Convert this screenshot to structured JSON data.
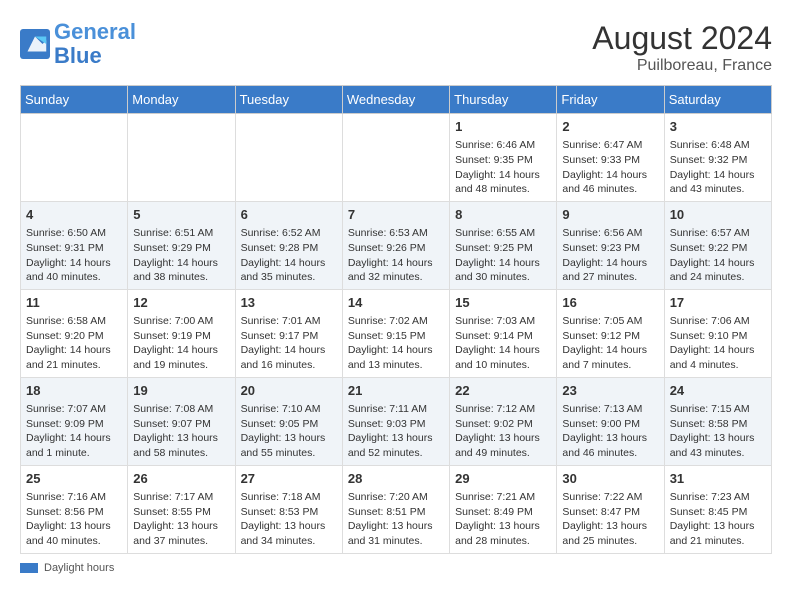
{
  "header": {
    "logo_line1": "General",
    "logo_line2": "Blue",
    "month_year": "August 2024",
    "location": "Puilboreau, France"
  },
  "weekdays": [
    "Sunday",
    "Monday",
    "Tuesday",
    "Wednesday",
    "Thursday",
    "Friday",
    "Saturday"
  ],
  "weeks": [
    [
      {
        "day": "",
        "info": ""
      },
      {
        "day": "",
        "info": ""
      },
      {
        "day": "",
        "info": ""
      },
      {
        "day": "",
        "info": ""
      },
      {
        "day": "1",
        "info": "Sunrise: 6:46 AM\nSunset: 9:35 PM\nDaylight: 14 hours\nand 48 minutes."
      },
      {
        "day": "2",
        "info": "Sunrise: 6:47 AM\nSunset: 9:33 PM\nDaylight: 14 hours\nand 46 minutes."
      },
      {
        "day": "3",
        "info": "Sunrise: 6:48 AM\nSunset: 9:32 PM\nDaylight: 14 hours\nand 43 minutes."
      }
    ],
    [
      {
        "day": "4",
        "info": "Sunrise: 6:50 AM\nSunset: 9:31 PM\nDaylight: 14 hours\nand 40 minutes."
      },
      {
        "day": "5",
        "info": "Sunrise: 6:51 AM\nSunset: 9:29 PM\nDaylight: 14 hours\nand 38 minutes."
      },
      {
        "day": "6",
        "info": "Sunrise: 6:52 AM\nSunset: 9:28 PM\nDaylight: 14 hours\nand 35 minutes."
      },
      {
        "day": "7",
        "info": "Sunrise: 6:53 AM\nSunset: 9:26 PM\nDaylight: 14 hours\nand 32 minutes."
      },
      {
        "day": "8",
        "info": "Sunrise: 6:55 AM\nSunset: 9:25 PM\nDaylight: 14 hours\nand 30 minutes."
      },
      {
        "day": "9",
        "info": "Sunrise: 6:56 AM\nSunset: 9:23 PM\nDaylight: 14 hours\nand 27 minutes."
      },
      {
        "day": "10",
        "info": "Sunrise: 6:57 AM\nSunset: 9:22 PM\nDaylight: 14 hours\nand 24 minutes."
      }
    ],
    [
      {
        "day": "11",
        "info": "Sunrise: 6:58 AM\nSunset: 9:20 PM\nDaylight: 14 hours\nand 21 minutes."
      },
      {
        "day": "12",
        "info": "Sunrise: 7:00 AM\nSunset: 9:19 PM\nDaylight: 14 hours\nand 19 minutes."
      },
      {
        "day": "13",
        "info": "Sunrise: 7:01 AM\nSunset: 9:17 PM\nDaylight: 14 hours\nand 16 minutes."
      },
      {
        "day": "14",
        "info": "Sunrise: 7:02 AM\nSunset: 9:15 PM\nDaylight: 14 hours\nand 13 minutes."
      },
      {
        "day": "15",
        "info": "Sunrise: 7:03 AM\nSunset: 9:14 PM\nDaylight: 14 hours\nand 10 minutes."
      },
      {
        "day": "16",
        "info": "Sunrise: 7:05 AM\nSunset: 9:12 PM\nDaylight: 14 hours\nand 7 minutes."
      },
      {
        "day": "17",
        "info": "Sunrise: 7:06 AM\nSunset: 9:10 PM\nDaylight: 14 hours\nand 4 minutes."
      }
    ],
    [
      {
        "day": "18",
        "info": "Sunrise: 7:07 AM\nSunset: 9:09 PM\nDaylight: 14 hours\nand 1 minute."
      },
      {
        "day": "19",
        "info": "Sunrise: 7:08 AM\nSunset: 9:07 PM\nDaylight: 13 hours\nand 58 minutes."
      },
      {
        "day": "20",
        "info": "Sunrise: 7:10 AM\nSunset: 9:05 PM\nDaylight: 13 hours\nand 55 minutes."
      },
      {
        "day": "21",
        "info": "Sunrise: 7:11 AM\nSunset: 9:03 PM\nDaylight: 13 hours\nand 52 minutes."
      },
      {
        "day": "22",
        "info": "Sunrise: 7:12 AM\nSunset: 9:02 PM\nDaylight: 13 hours\nand 49 minutes."
      },
      {
        "day": "23",
        "info": "Sunrise: 7:13 AM\nSunset: 9:00 PM\nDaylight: 13 hours\nand 46 minutes."
      },
      {
        "day": "24",
        "info": "Sunrise: 7:15 AM\nSunset: 8:58 PM\nDaylight: 13 hours\nand 43 minutes."
      }
    ],
    [
      {
        "day": "25",
        "info": "Sunrise: 7:16 AM\nSunset: 8:56 PM\nDaylight: 13 hours\nand 40 minutes."
      },
      {
        "day": "26",
        "info": "Sunrise: 7:17 AM\nSunset: 8:55 PM\nDaylight: 13 hours\nand 37 minutes."
      },
      {
        "day": "27",
        "info": "Sunrise: 7:18 AM\nSunset: 8:53 PM\nDaylight: 13 hours\nand 34 minutes."
      },
      {
        "day": "28",
        "info": "Sunrise: 7:20 AM\nSunset: 8:51 PM\nDaylight: 13 hours\nand 31 minutes."
      },
      {
        "day": "29",
        "info": "Sunrise: 7:21 AM\nSunset: 8:49 PM\nDaylight: 13 hours\nand 28 minutes."
      },
      {
        "day": "30",
        "info": "Sunrise: 7:22 AM\nSunset: 8:47 PM\nDaylight: 13 hours\nand 25 minutes."
      },
      {
        "day": "31",
        "info": "Sunrise: 7:23 AM\nSunset: 8:45 PM\nDaylight: 13 hours\nand 21 minutes."
      }
    ]
  ],
  "legend": {
    "daylight_hours": "Daylight hours"
  }
}
